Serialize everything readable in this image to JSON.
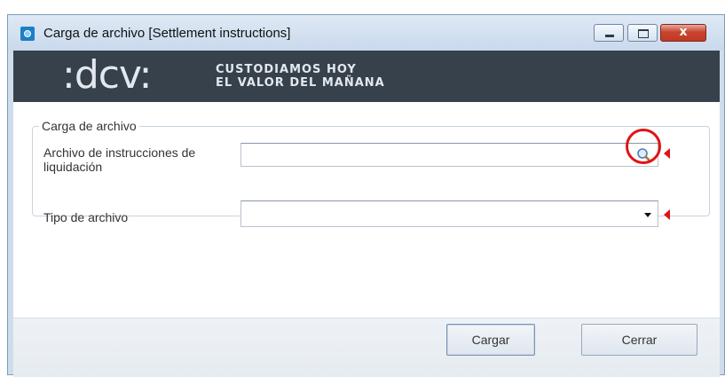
{
  "window": {
    "title": "Carga de archivo [Settlement instructions]",
    "close_glyph": "x"
  },
  "banner": {
    "logo_text": ":dcv:",
    "tagline_line1": "CUSTODIAMOS HOY",
    "tagline_line2": "EL VALOR DEL MAÑANA"
  },
  "form": {
    "group_title": "Carga de archivo",
    "file_label": "Archivo de instrucciones de liquidación",
    "file_value": "",
    "type_label": "Tipo de archivo",
    "type_value": ""
  },
  "buttons": {
    "load_label": "Cargar",
    "close_label": "Cerrar"
  },
  "colors": {
    "banner_bg": "#36414b",
    "required_marker": "#e01414",
    "annotation": "#e01414"
  },
  "icons": [
    "app-icon",
    "minimize-icon",
    "maximize-icon",
    "close-icon",
    "search-icon",
    "dropdown-arrow-icon",
    "required-marker-icon"
  ]
}
